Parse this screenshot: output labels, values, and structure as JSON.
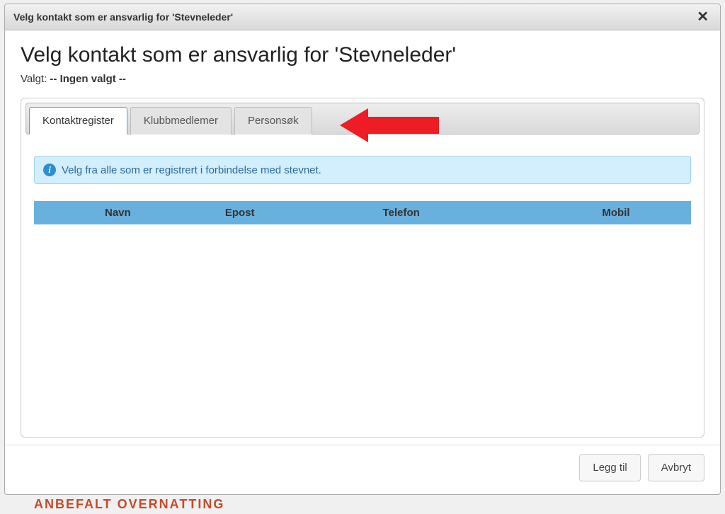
{
  "dialog": {
    "title": "Velg kontakt som er ansvarlig for 'Stevneleder'",
    "heading": "Velg kontakt som er ansvarlig for 'Stevneleder'",
    "selected_label": "Valgt: ",
    "selected_value": "-- Ingen valgt --"
  },
  "tabs": [
    {
      "label": "Kontaktregister",
      "active": true
    },
    {
      "label": "Klubbmedlemer",
      "active": false
    },
    {
      "label": "Personsøk",
      "active": false
    }
  ],
  "info": {
    "icon": "i",
    "text": "Velg fra alle som er registrert i forbindelse med stevnet."
  },
  "table": {
    "columns": [
      "Navn",
      "Epost",
      "Telefon",
      "Mobil"
    ],
    "rows": []
  },
  "footer": {
    "add_label": "Legg til",
    "cancel_label": "Avbryt"
  },
  "background_text": "ANBEFALT OVERNATTING"
}
